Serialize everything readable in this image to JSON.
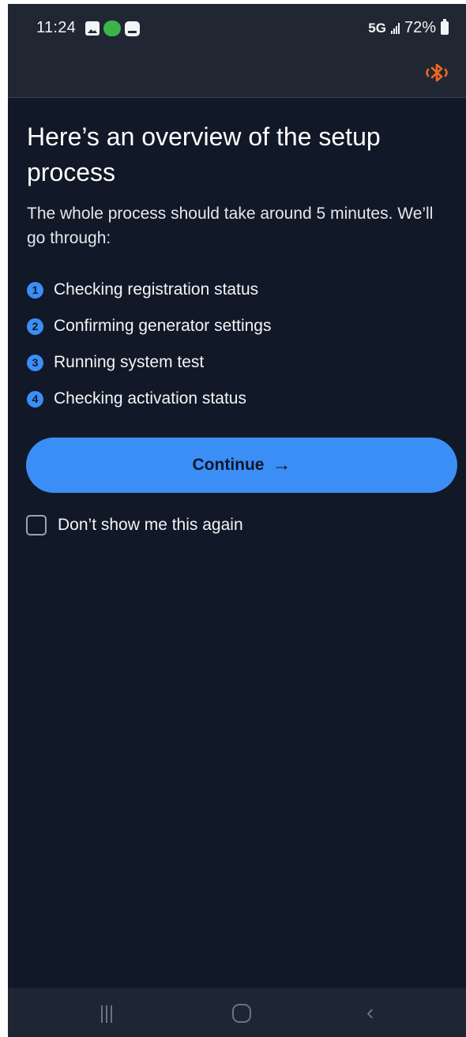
{
  "status_bar": {
    "time": "11:24",
    "network": "5G",
    "battery": "72%"
  },
  "app_bar": {
    "bluetooth_icon": "bluetooth-icon",
    "bluetooth_color": "#f26522"
  },
  "content": {
    "title": "Here’s an overview of the setup process",
    "subtitle": "The whole process should take around 5 minutes. We’ll go through:",
    "steps": [
      {
        "num": "1",
        "label": "Checking registration status"
      },
      {
        "num": "2",
        "label": "Confirming generator settings"
      },
      {
        "num": "3",
        "label": "Running system test"
      },
      {
        "num": "4",
        "label": "Checking activation status"
      }
    ],
    "continue_label": "Continue",
    "continue_arrow": "→",
    "dont_show_label": "Don’t show me this again"
  },
  "colors": {
    "background": "#111827",
    "accent": "#3b8ef6"
  },
  "navbar": {
    "back_glyph": "‹"
  }
}
